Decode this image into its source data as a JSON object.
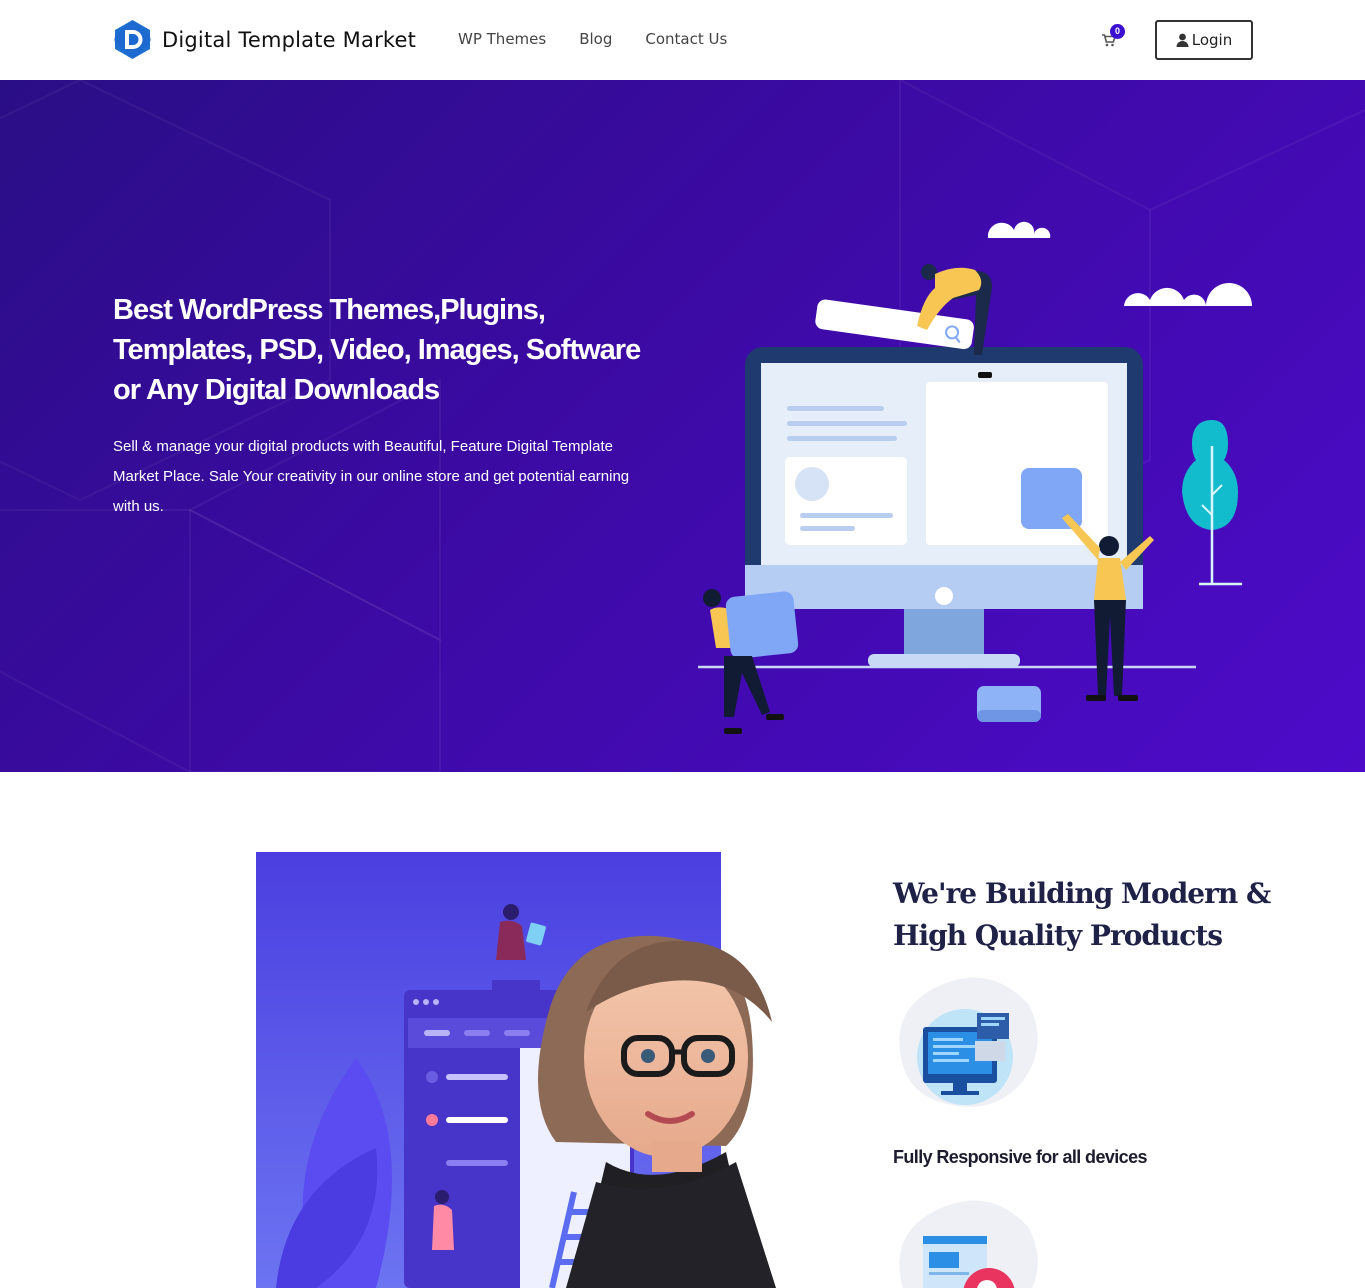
{
  "brand": {
    "name": "Digital Template Market"
  },
  "nav": {
    "items": [
      "WP Themes",
      "Blog",
      "Contact Us"
    ]
  },
  "cart": {
    "count": "0"
  },
  "login": {
    "label": "Login"
  },
  "hero": {
    "title": "Best WordPress Themes,Plugins, Templates, PSD, Video, Images, Software or Any Digital Downloads",
    "description": "Sell & manage your digital products with Beautiful, Feature Digital Template Market Place. Sale Your creativity in our online store and get potential earning with us."
  },
  "about": {
    "title": "We're Building Modern & High Quality Products",
    "features": [
      {
        "label": "Fully Responsive for all devices",
        "icon": "monitor-icon"
      },
      {
        "label": "",
        "icon": "browser-search-icon"
      }
    ]
  },
  "colors": {
    "hero_start": "#2a0e86",
    "hero_end": "#4d0bc9",
    "accent": "#3b0fd0",
    "heading_dark": "#1f2147"
  }
}
